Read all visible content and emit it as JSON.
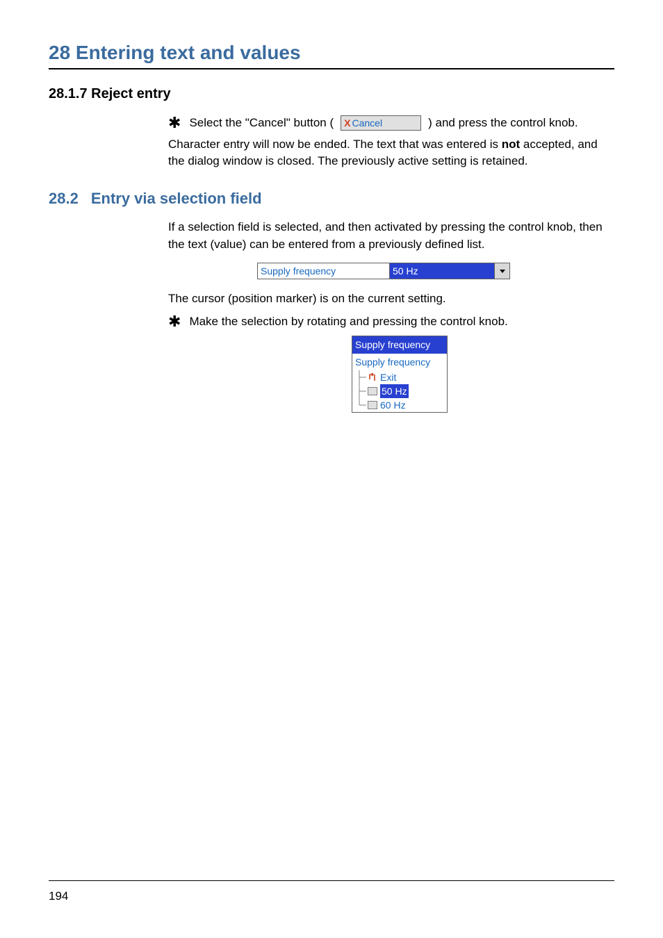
{
  "chapter_heading": "28 Entering text and values",
  "subsection_heading": "28.1.7  Reject entry",
  "section_number": "28.2",
  "section_title": "Entry via selection field",
  "page_number": "194",
  "reject_entry": {
    "select_text_before": "Select the \"Cancel\" button ( ",
    "select_text_after": " ) and press the control knob.",
    "cancel_button_x": "X",
    "cancel_button_label": "Cancel",
    "paragraph_part1": "Character entry will now be ended. The text that was entered is ",
    "paragraph_bold": "not",
    "paragraph_part2": " accepted, and the dialog window is closed. The previously active setting is retained."
  },
  "selection_entry": {
    "intro": "If a selection field is selected, and then activated by pressing the control knob, then the text (value) can be entered from a previously defined list.",
    "field_label": "Supply frequency",
    "field_value": "50 Hz",
    "cursor_text": "The cursor (position marker) is on the current setting.",
    "make_selection": "Make the selection by rotating and pressing the control knob.",
    "dropdown_header": "Supply frequency",
    "dropdown_title_row": "Supply frequency",
    "dropdown_exit": "Exit",
    "dropdown_50hz": "50 Hz",
    "dropdown_60hz": "60 Hz"
  }
}
